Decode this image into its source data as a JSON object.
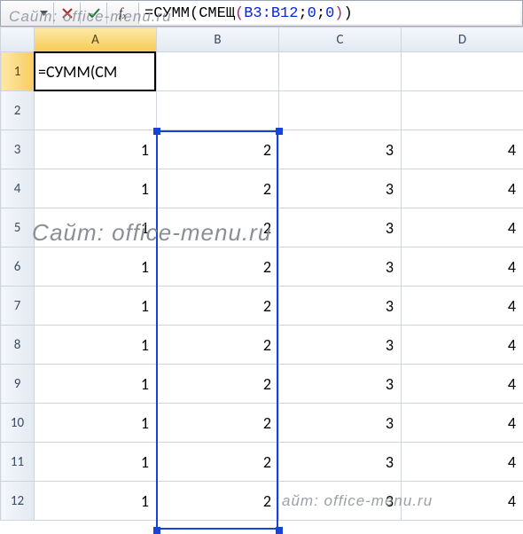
{
  "formula_bar": {
    "formula_plain": "=СУММ(СМЕЩ(B3:B12;0;0))",
    "parts": {
      "p1": "=СУММ(СМЕЩ",
      "lp": "(",
      "ref": "B3:B12",
      "s1": ";",
      "z1": "0",
      "s2": ";",
      "z2": "0",
      "rp": ")",
      "p2": ")"
    }
  },
  "columns": [
    "A",
    "B",
    "C",
    "D"
  ],
  "rows": [
    "1",
    "2",
    "3",
    "4",
    "5",
    "6",
    "7",
    "8",
    "9",
    "10",
    "11",
    "12"
  ],
  "active_cell": {
    "address": "A1",
    "display": "=СУММ(СМ"
  },
  "selection_range": "B3:B12",
  "data": {
    "A": [
      "",
      "",
      "1",
      "1",
      "1",
      "1",
      "1",
      "1",
      "1",
      "1",
      "1",
      "1"
    ],
    "B": [
      "",
      "",
      "2",
      "2",
      "2",
      "2",
      "2",
      "2",
      "2",
      "2",
      "2",
      "2"
    ],
    "C": [
      "",
      "",
      "3",
      "3",
      "3",
      "3",
      "3",
      "3",
      "3",
      "3",
      "3",
      "3"
    ],
    "D": [
      "",
      "",
      "4",
      "4",
      "4",
      "4",
      "4",
      "4",
      "4",
      "4",
      "4",
      "4"
    ]
  },
  "watermark": {
    "full": "Сайт: office-menu.ru",
    "partial": "айт: office-menu.ru"
  }
}
